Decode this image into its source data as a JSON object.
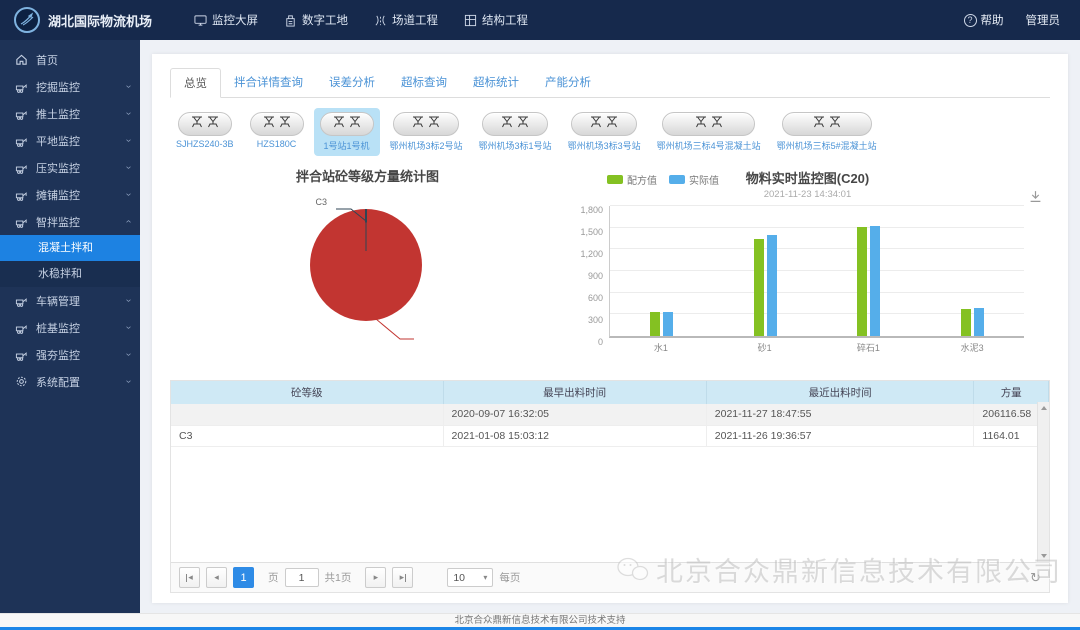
{
  "header": {
    "brand": "湖北国际物流机场",
    "nav": [
      {
        "label": "监控大屏",
        "icon": "big-screen-icon"
      },
      {
        "label": "数字工地",
        "icon": "digital-site-icon"
      },
      {
        "label": "场道工程",
        "icon": "runway-works-icon"
      },
      {
        "label": "结构工程",
        "icon": "structure-works-icon"
      }
    ],
    "help_label": "帮助",
    "user_label": "管理员"
  },
  "sidebar": {
    "items": [
      {
        "label": "首页",
        "icon": "home-icon",
        "expandable": false
      },
      {
        "label": "挖掘监控",
        "icon": "excavator-icon",
        "expandable": true
      },
      {
        "label": "推土监控",
        "icon": "bulldozer-icon",
        "expandable": true
      },
      {
        "label": "平地监控",
        "icon": "grader-icon",
        "expandable": true
      },
      {
        "label": "压实监控",
        "icon": "compactor-icon",
        "expandable": true
      },
      {
        "label": "摊铺监控",
        "icon": "paver-icon",
        "expandable": true
      },
      {
        "label": "智拌监控",
        "icon": "smart-mixing-icon",
        "expandable": true,
        "expanded": true,
        "children": [
          {
            "label": "混凝土拌和",
            "active": true
          },
          {
            "label": "水稳拌和",
            "active": false
          }
        ]
      },
      {
        "label": "车辆管理",
        "icon": "vehicle-icon",
        "expandable": true
      },
      {
        "label": "桩基监控",
        "icon": "pile-icon",
        "expandable": true
      },
      {
        "label": "强夯监控",
        "icon": "ramming-icon",
        "expandable": true
      },
      {
        "label": "系统配置",
        "icon": "settings-icon",
        "expandable": true
      }
    ]
  },
  "tabs": {
    "items": [
      "总览",
      "拌合详情查询",
      "误差分析",
      "超标查询",
      "超标统计",
      "产能分析"
    ],
    "active_index": 0
  },
  "stations": {
    "items": [
      "SJHZS240-3B",
      "HZS180C",
      "1号站1号机",
      "鄂州机场3标2号站",
      "鄂州机场3标1号站",
      "鄂州机场3标3号站",
      "鄂州机场三标4号混凝土站",
      "鄂州机场三标5#混凝土站"
    ],
    "selected_index": 2
  },
  "chart_data": [
    {
      "type": "pie",
      "title": "拌合站砼等级方量统计图",
      "slices": [
        {
          "label": "",
          "value": 206116.58,
          "color": "#c23531"
        },
        {
          "label": "C3",
          "value": 1164.01,
          "color": "#2f4554"
        }
      ],
      "legend_position": "none"
    },
    {
      "type": "bar",
      "title": "物料实时监控图(C20)",
      "subtitle": "2021-11-23 14:34:01",
      "categories": [
        "水1",
        "砂1",
        "碎石1",
        "水泥3"
      ],
      "series": [
        {
          "name": "配方值",
          "color": "#84c122",
          "values": [
            330,
            1340,
            1515,
            378
          ]
        },
        {
          "name": "实际值",
          "color": "#55aeea",
          "values": [
            335,
            1405,
            1530,
            383
          ]
        }
      ],
      "ylim": [
        0,
        1800
      ],
      "ytick_step": 300,
      "yticks": [
        "0",
        "300",
        "600",
        "900",
        "1,200",
        "1,500",
        "1,800"
      ],
      "grid": true,
      "legend_position": "top-left"
    }
  ],
  "table": {
    "headers": [
      "砼等级",
      "最早出料时间",
      "最近出料时间",
      "方量"
    ],
    "rows": [
      [
        "",
        "2020-09-07 16:32:05",
        "2021-11-27 18:47:55",
        "206116.58"
      ],
      [
        "C3",
        "2021-01-08 15:03:12",
        "2021-11-26 19:36:57",
        "1164.01"
      ]
    ]
  },
  "pagination": {
    "page": "1",
    "page_label": "页",
    "page_input": "1",
    "total_label": "共1页",
    "page_size": "10",
    "per_page_label": "每页"
  },
  "watermark": {
    "text": "北京合众鼎新信息技术有限公司"
  },
  "footer": {
    "text": "北京合众鼎新信息技术有限公司技术支持"
  }
}
